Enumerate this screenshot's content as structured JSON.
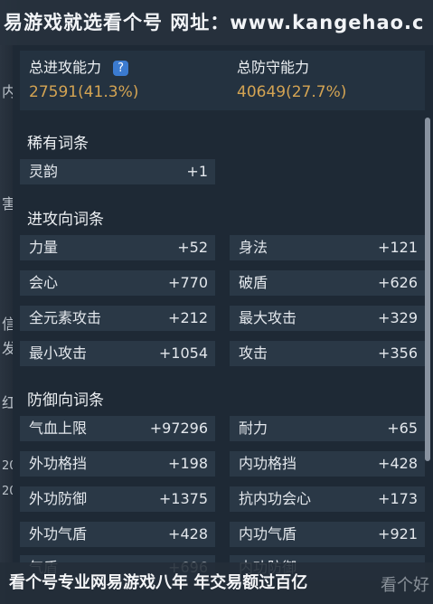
{
  "watermark": {
    "top": "易游戏就选看个号  网址：www.kangehao.c",
    "bottom": "看个号专业网易游戏八年  年交易额过百亿",
    "logo": "看个好"
  },
  "left_edge_glyphs": [
    "内",
    "害",
    "信",
    "发",
    "红",
    "20",
    "20"
  ],
  "summary": {
    "attack_label": "总进攻能力",
    "attack_value": "27591(41.3%)",
    "defense_label": "总防守能力",
    "defense_value": "40649(27.7%)"
  },
  "sections": {
    "rare_title": "稀有词条",
    "attack_title": "进攻向词条",
    "defense_title": "防御向词条"
  },
  "rare": [
    {
      "name": "灵韵",
      "value": "+1"
    }
  ],
  "attack": [
    {
      "name": "力量",
      "value": "+52"
    },
    {
      "name": "身法",
      "value": "+121"
    },
    {
      "name": "会心",
      "value": "+770"
    },
    {
      "name": "破盾",
      "value": "+626"
    },
    {
      "name": "全元素攻击",
      "value": "+212"
    },
    {
      "name": "最大攻击",
      "value": "+329"
    },
    {
      "name": "最小攻击",
      "value": "+1054"
    },
    {
      "name": "攻击",
      "value": "+356"
    }
  ],
  "defense": [
    {
      "name": "气血上限",
      "value": "+97296"
    },
    {
      "name": "耐力",
      "value": "+65"
    },
    {
      "name": "外功格挡",
      "value": "+198"
    },
    {
      "name": "内功格挡",
      "value": "+428"
    },
    {
      "name": "外功防御",
      "value": "+1375"
    },
    {
      "name": "抗内功会心",
      "value": "+173"
    },
    {
      "name": "外功气盾",
      "value": "+428"
    },
    {
      "name": "内功气盾",
      "value": "+921"
    },
    {
      "name": "气盾",
      "value": "+696"
    },
    {
      "name": "内功防御",
      "value": ""
    }
  ],
  "colors": {
    "value_gold": "#d4a453",
    "row_bg": "#2a3846",
    "panel_bg": "#1e2935",
    "help_icon_blue": "#3b7bd0"
  }
}
